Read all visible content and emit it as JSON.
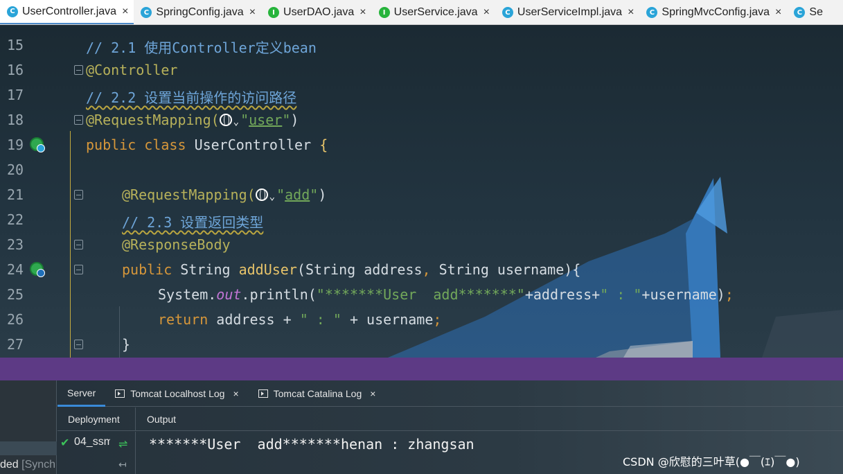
{
  "tabs": [
    {
      "label": "UserController.java",
      "kind": "C",
      "active": true
    },
    {
      "label": "SpringConfig.java",
      "kind": "C"
    },
    {
      "label": "UserDAO.java",
      "kind": "I"
    },
    {
      "label": "UserService.java",
      "kind": "I"
    },
    {
      "label": "UserServiceImpl.java",
      "kind": "C"
    },
    {
      "label": "SpringMvcConfig.java",
      "kind": "C"
    },
    {
      "label": "Se",
      "kind": "C"
    }
  ],
  "tab_close_glyph": "×",
  "editor": {
    "lines": [
      {
        "n": "15",
        "comment": "// 2.1 使用Controller定义bean"
      },
      {
        "n": "16",
        "annotation": "@Controller"
      },
      {
        "n": "17",
        "comment": "// 2.2 设置当前操作的访问路径"
      },
      {
        "n": "18",
        "annotation": "@RequestMapping(",
        "path": "user",
        "close": ")"
      },
      {
        "n": "19",
        "kw1": "public",
        "kw2": "class",
        "name": "UserController",
        "brace": "{"
      },
      {
        "n": "20"
      },
      {
        "n": "21",
        "annotation": "@RequestMapping(",
        "path": "add",
        "close": ")"
      },
      {
        "n": "22",
        "comment": "// 2.3 设置返回类型"
      },
      {
        "n": "23",
        "annotation": "@ResponseBody"
      },
      {
        "n": "24",
        "kw1": "public",
        "type": "String",
        "method": "addUser",
        "params_open": "(",
        "p1type": "String",
        "p1": "address",
        "comma": ",",
        "p2type": "String",
        "p2": "username",
        "params_close": "){"
      },
      {
        "n": "25",
        "obj": "System.",
        "field": "out",
        "call": ".println(",
        "s1": "\"*******User  add*******\"",
        "mid": "+address+",
        "s2": "\" : \"",
        "tail": "+username)",
        "semi": ";"
      },
      {
        "n": "26",
        "kw": "return",
        "expr1": "address + ",
        "s": "\" : \"",
        "expr2": " + username",
        "semi": ";"
      },
      {
        "n": "27",
        "brace": "}"
      }
    ]
  },
  "bottom": {
    "tabs": [
      {
        "label": "Server",
        "active": true
      },
      {
        "label": "Tomcat Localhost Log"
      },
      {
        "label": "Tomcat Catalina Log"
      }
    ],
    "close_glyph": "×",
    "deployment_label": "Deployment",
    "output_label": "Output",
    "deployment_item": "04_ssm",
    "status_text": "ded",
    "status_dim": "[Synch",
    "output_line": "*******User  add*******henan : zhangsan",
    "watermark": "CSDN @欣慰的三叶草(●￣(ｴ)￣●)"
  },
  "colors": {
    "accent": "#4a88c7",
    "splitter": "#5d3a85",
    "check": "#3cc35a"
  }
}
